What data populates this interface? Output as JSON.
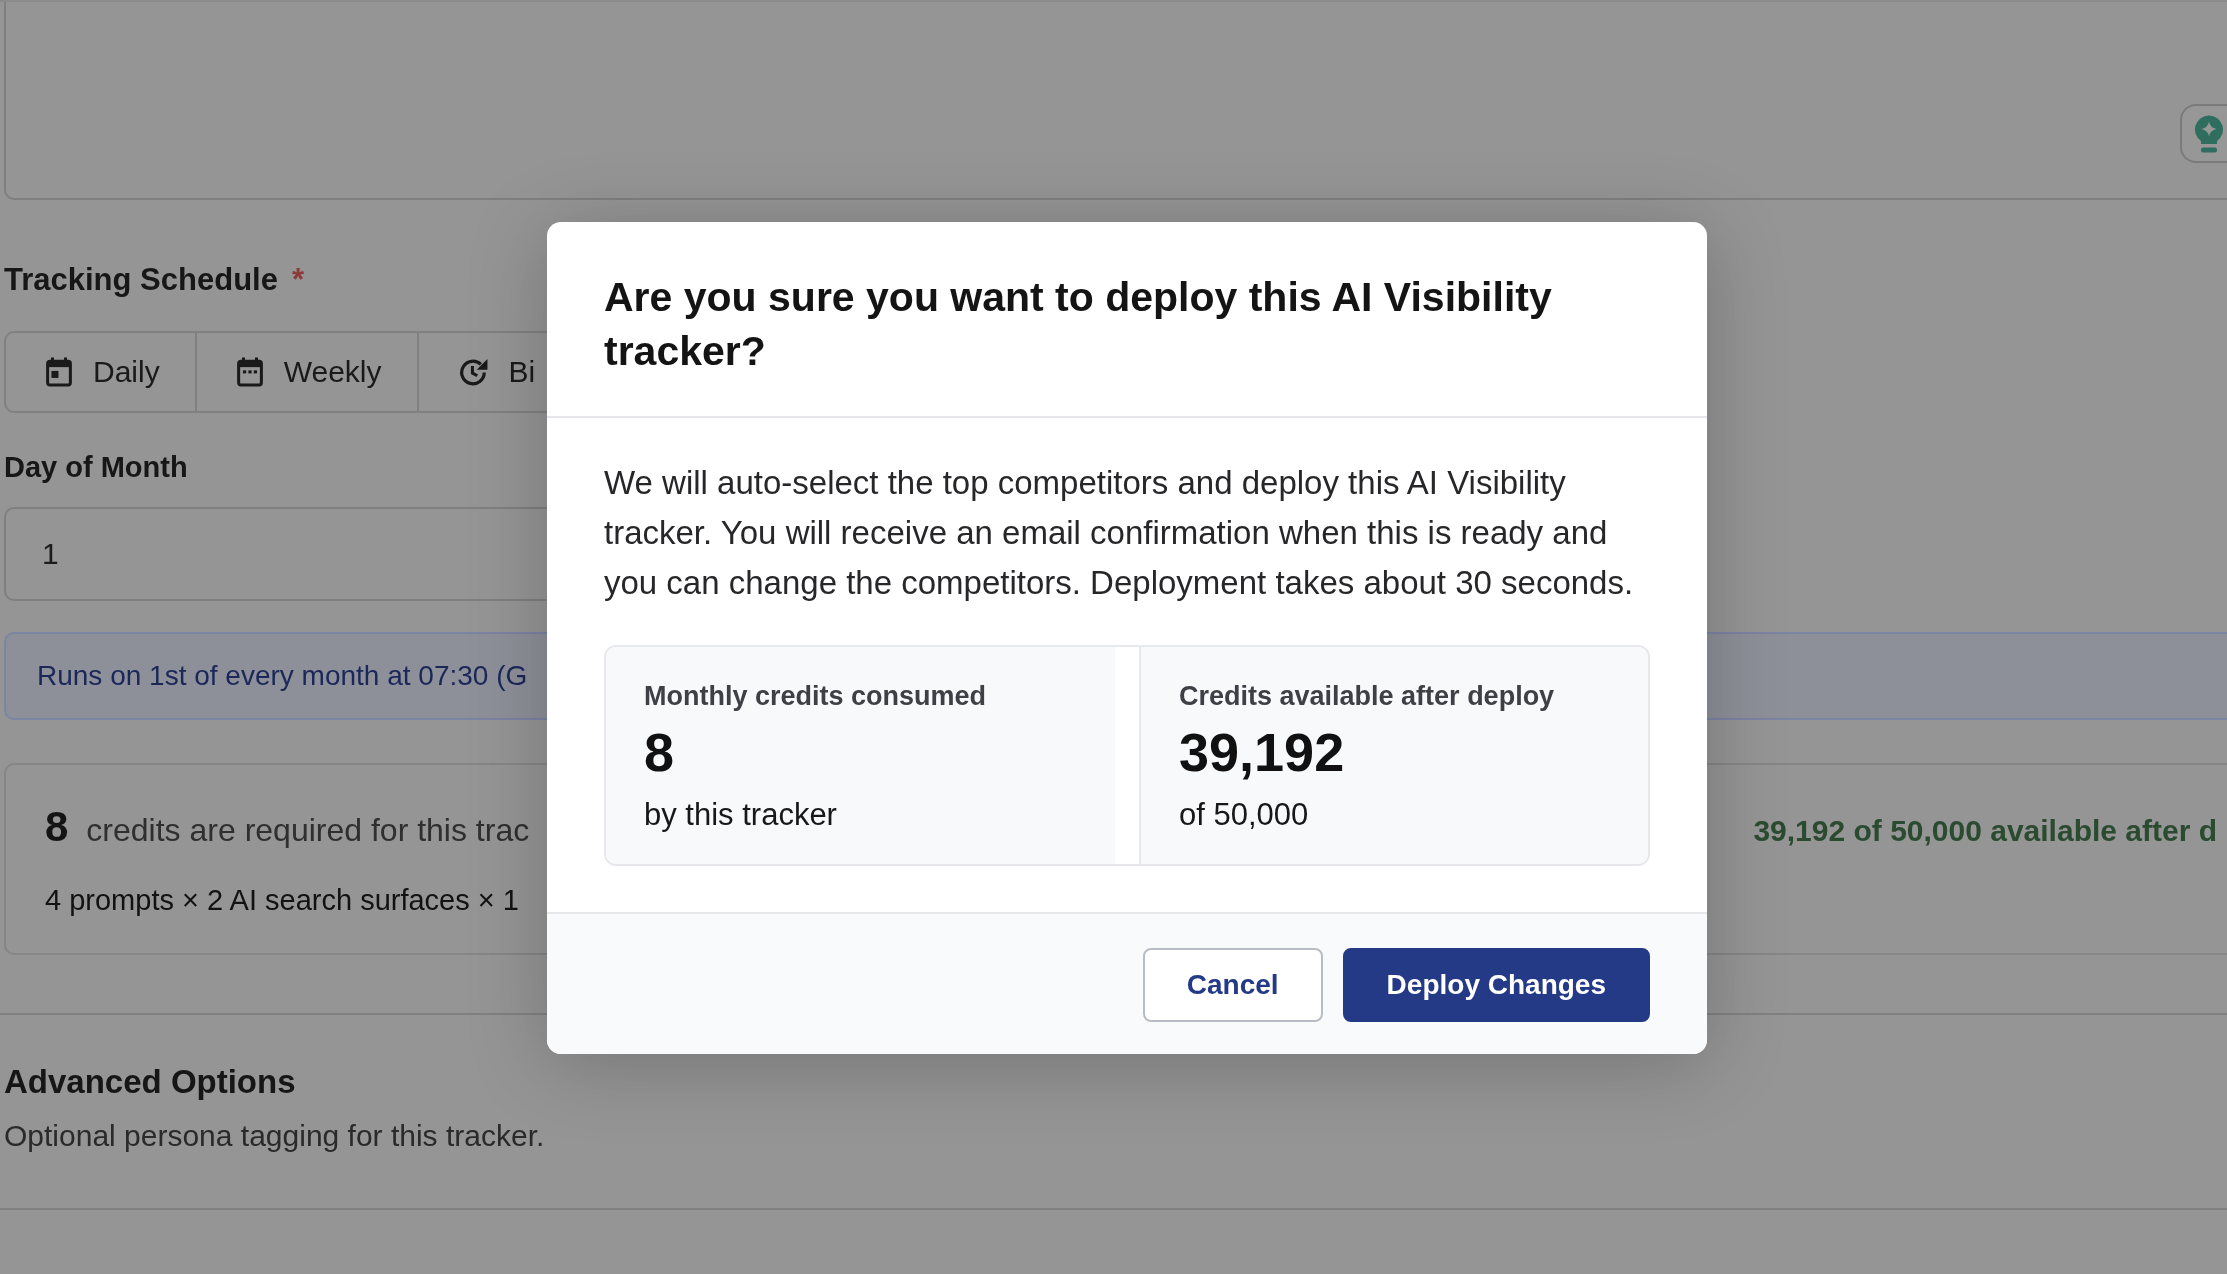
{
  "tracking_schedule": {
    "label": "Tracking Schedule",
    "required_marker": "*",
    "options": [
      {
        "label": "Daily",
        "kind": "day",
        "selected": false
      },
      {
        "label": "Weekly",
        "kind": "week",
        "selected": false
      },
      {
        "label": "Bi",
        "kind": "cycle",
        "selected": false
      }
    ]
  },
  "day_of_month": {
    "label": "Day of Month",
    "value": "1"
  },
  "schedule_note": "Runs on 1st of every month at 07:30 (G",
  "credits_panel": {
    "count": "8",
    "text": "credits are required for this trac",
    "formula": "4 prompts × 2 AI search surfaces × 1",
    "availability": "39,192 of 50,000 available after d"
  },
  "advanced_options": {
    "title": "Advanced Options",
    "description": "Optional persona tagging for this tracker."
  },
  "dialog": {
    "title": "Are you sure you want to deploy this AI Visibility tracker?",
    "message": "We will auto-select the top competitors and deploy this AI Visibility tracker. You will receive an email confirmation when this is ready and you can change the competitors. Deployment takes about 30 seconds.",
    "stats": [
      {
        "label": "Monthly credits consumed",
        "value": "8",
        "detail": "by this tracker"
      },
      {
        "label": "Credits available after deploy",
        "value": "39,192",
        "detail": "of 50,000"
      }
    ],
    "buttons": [
      {
        "label": "Cancel",
        "kind": "secondary"
      },
      {
        "label": "Deploy Changes",
        "kind": "primary"
      }
    ]
  }
}
